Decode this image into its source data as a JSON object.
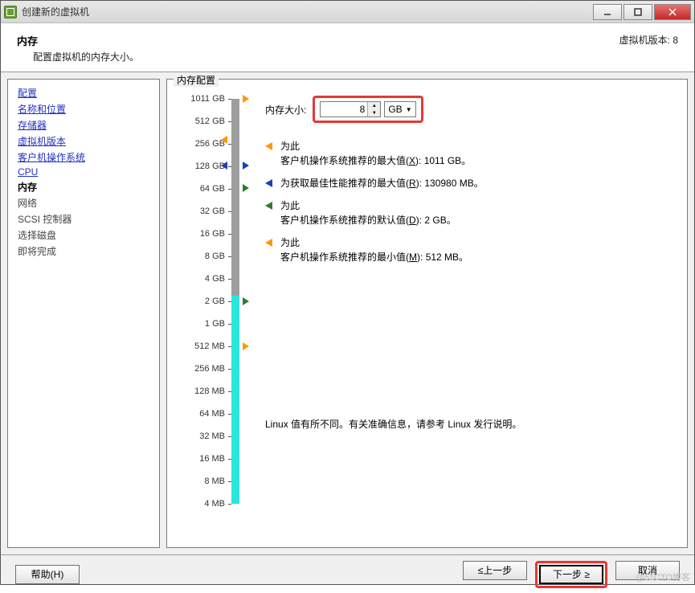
{
  "titlebar": {
    "title": "创建新的虚拟机"
  },
  "header": {
    "title": "内存",
    "desc": "配置虚拟机的内存大小。",
    "version": "虚拟机版本: 8"
  },
  "nav": {
    "links": [
      "配置",
      "名称和位置",
      "存储器",
      "虚拟机版本",
      "客户机操作系统",
      "CPU"
    ],
    "current": "内存",
    "pending": [
      "网络",
      "SCSI 控制器",
      "选择磁盘",
      "即将完成"
    ]
  },
  "group_label": "内存配置",
  "size_label": "内存大小:",
  "size_value": "8",
  "unit": "GB",
  "scale_ticks": [
    "1011 GB",
    "512 GB",
    "256 GB",
    "128 GB",
    "64 GB",
    "32 GB",
    "16 GB",
    "8 GB",
    "4 GB",
    "2 GB",
    "1 GB",
    "512 MB",
    "256 MB",
    "128 MB",
    "64 MB",
    "32 MB",
    "16 MB",
    "8 MB",
    "4 MB"
  ],
  "recs": [
    {
      "color": "#ff9800",
      "prefix": "为此",
      "text": "客户机操作系统推荐的最大值",
      "key": "X",
      "val": "1011 GB。"
    },
    {
      "color": "#1c3fb3",
      "prefix": "",
      "text": "为获取最佳性能推荐的最大值",
      "key": "R",
      "val": "130980 MB。"
    },
    {
      "color": "#2e7d32",
      "prefix": "为此",
      "text": "客户机操作系统推荐的默认值",
      "key": "D",
      "val": "2 GB。"
    },
    {
      "color": "#ff9800",
      "prefix": "为此",
      "text": "客户机操作系统推荐的最小值",
      "key": "M",
      "val": "512 MB。"
    }
  ],
  "footnote": "Linux 值有所不同。有关准确信息，请参考 Linux 发行说明。",
  "buttons": {
    "help": "帮助(H)",
    "back": "≤上一步",
    "next": "下一步 ≥",
    "cancel": "取消"
  },
  "watermark": "@51CTO博客"
}
